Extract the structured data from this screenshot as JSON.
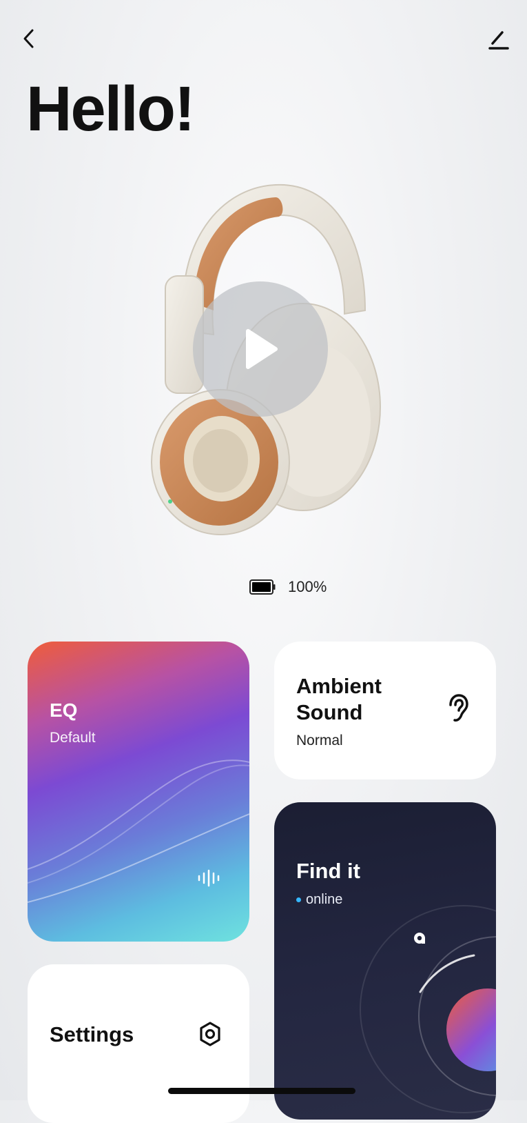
{
  "header": {
    "back_icon": "chevron-left-icon",
    "edit_icon": "pencil-icon",
    "title": "Hello!"
  },
  "hero": {
    "play_icon": "play-icon"
  },
  "battery": {
    "icon": "battery-full-icon",
    "level_text": "100%",
    "level_fraction": 1.0
  },
  "cards": {
    "eq": {
      "title": "EQ",
      "subtitle": "Default",
      "icon": "equalizer-bars-icon"
    },
    "ambient": {
      "title": "Ambient Sound",
      "subtitle": "Normal",
      "icon": "ear-icon"
    },
    "find": {
      "title": "Find it",
      "status": "online",
      "status_color": "#35b7ff",
      "icon": "location-pin-icon"
    },
    "settings": {
      "title": "Settings",
      "icon": "settings-ring-icon"
    }
  },
  "colors": {
    "eq_gradient": [
      "#ef5d3a",
      "#7c4ad3",
      "#6fe2df"
    ],
    "find_bg": "#1b1e33",
    "headband_accent": "#c9875b"
  }
}
